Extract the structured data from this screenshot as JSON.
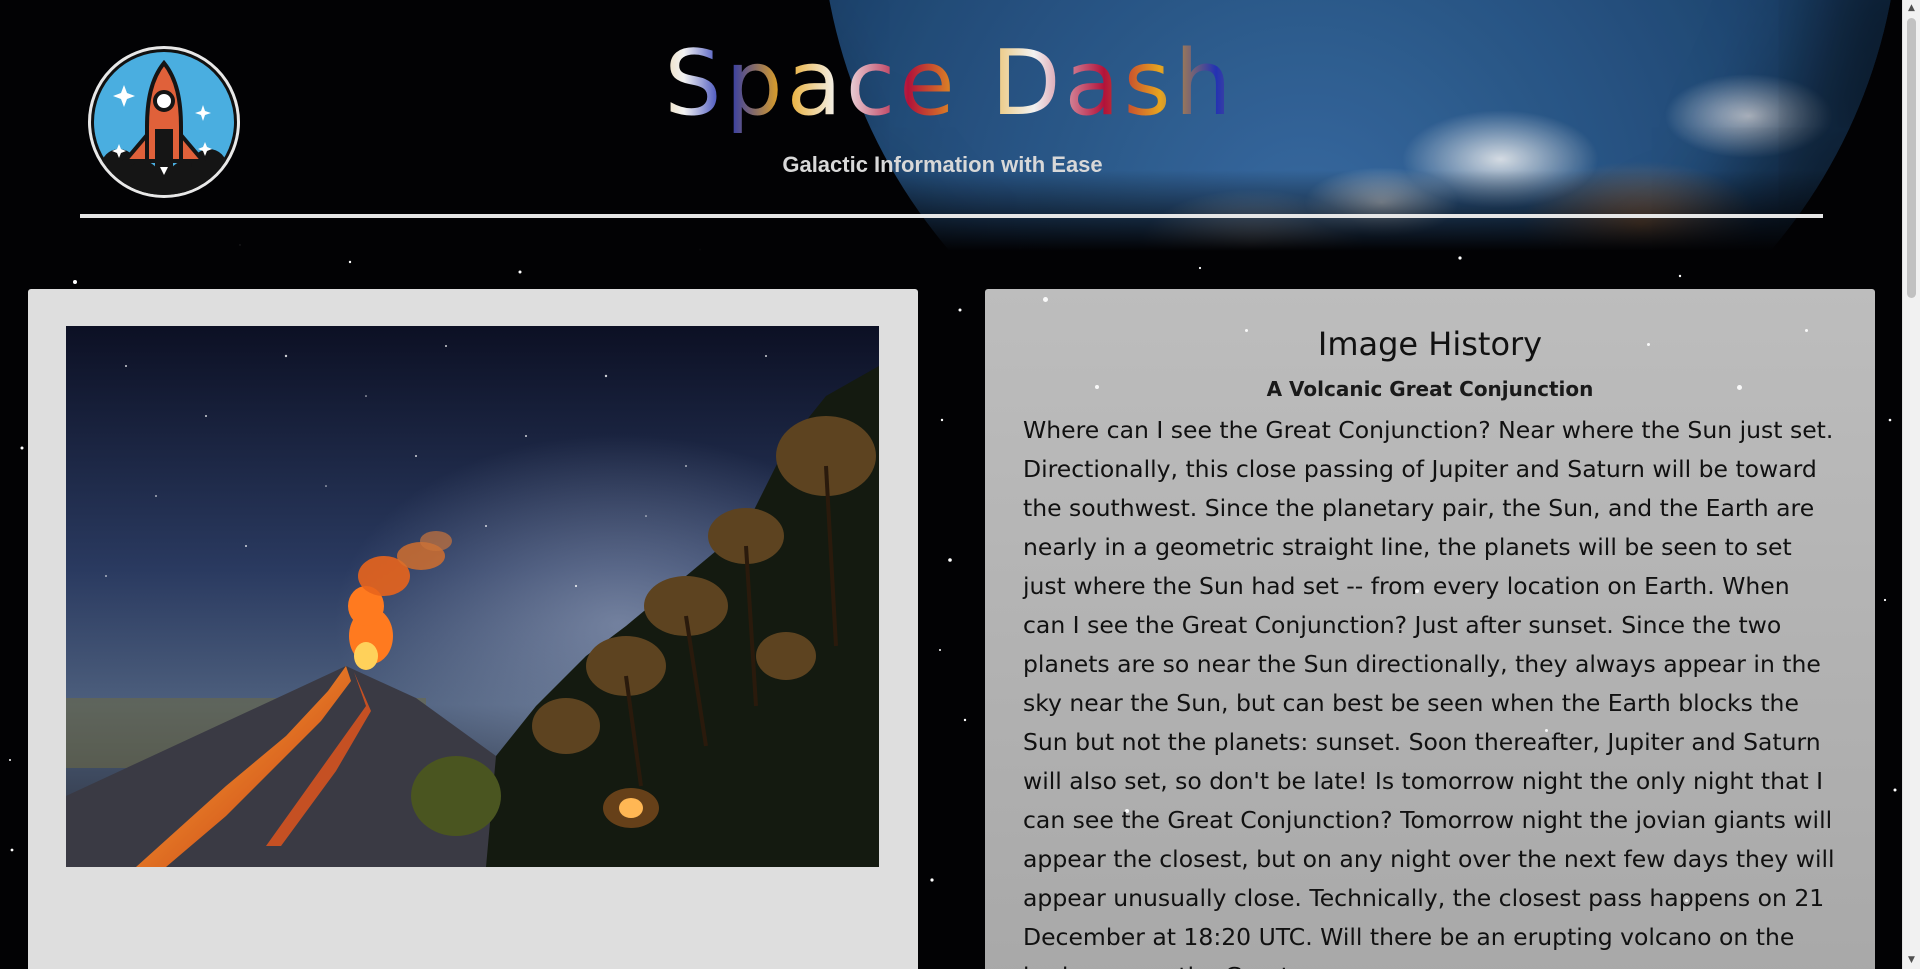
{
  "header": {
    "site_title": "Space Dash",
    "tagline": "Galactic Information with Ease",
    "logo_icon": "rocket-icon"
  },
  "image_panel": {
    "image_subject": "erupting volcano under night sky with trees"
  },
  "history_panel": {
    "heading": "Image History",
    "subheading": "A Volcanic Great Conjunction",
    "body": "Where can I see the Great Conjunction? Near where the Sun just set. Directionally, this close passing of Jupiter and Saturn will be toward the southwest. Since the planetary pair, the Sun, and the Earth are nearly in a geometric straight line, the planets will be seen to set just where the Sun had set -- from every location on Earth. When can I see the Great Conjunction? Just after sunset. Since the two planets are so near the Sun directionally, they always appear in the sky near the Sun, but can best be seen when the Earth blocks the Sun but not the planets: sunset. Soon thereafter, Jupiter and Saturn will also set, so don't be late! Is tomorrow night the only night that I can see the Great Conjunction? Tomorrow night the jovian giants will appear the closest, but on any night over the next few days they will appear unusually close. Technically, the closest pass happens on 21 December at 18:20 UTC. Will there be an erupting volcano on the horizon near the Great"
  },
  "colors": {
    "page_background": "#020204",
    "panel_left": "#dedede",
    "panel_right": "#b3b3b3",
    "title_gold": "#e7a51f",
    "title_red": "#b2123a",
    "title_blue": "#2332b3",
    "logo_sky": "#4aaee0",
    "rocket_orange": "#e0613a"
  }
}
